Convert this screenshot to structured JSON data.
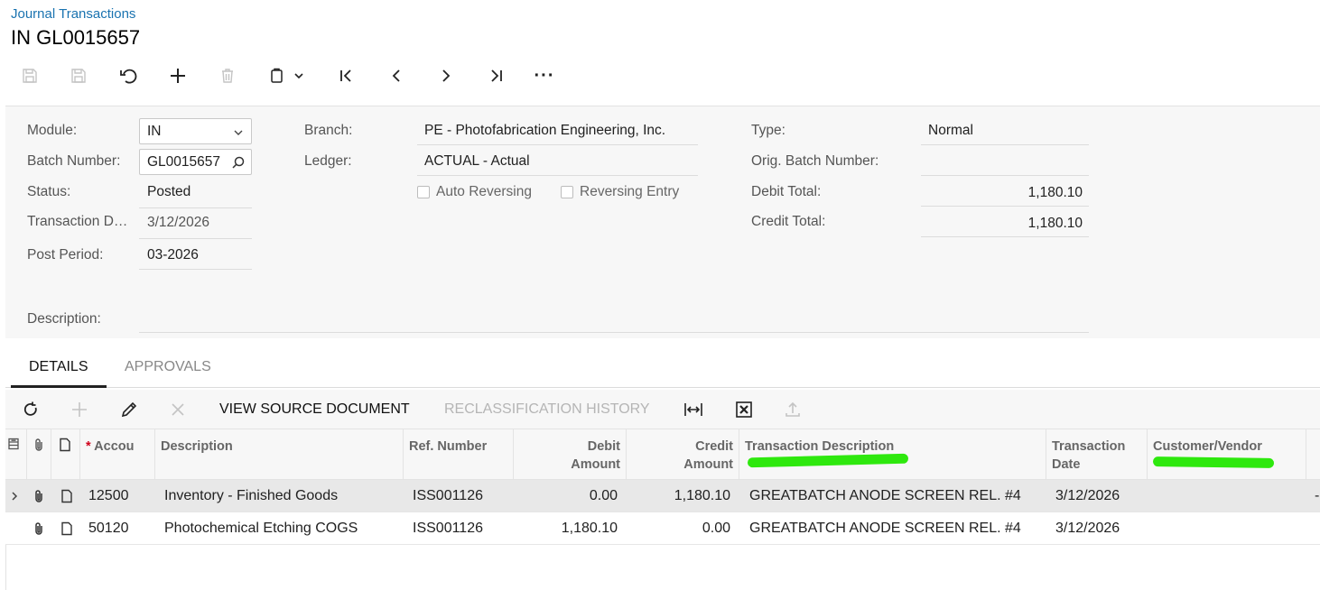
{
  "header": {
    "breadcrumb": "Journal Transactions",
    "title": "IN GL0015657"
  },
  "toolbar": {
    "icons": [
      "save-close-icon",
      "save-icon",
      "undo-icon",
      "add-icon",
      "delete-icon",
      "copy-paste-icon",
      "chevron-down-icon",
      "first-record-icon",
      "previous-icon",
      "next-icon",
      "last-record-icon",
      "more-icon"
    ],
    "more_label": "···"
  },
  "form": {
    "module_label": "Module:",
    "module_value": "IN",
    "batch_label": "Batch Number:",
    "batch_value": "GL0015657",
    "status_label": "Status:",
    "status_value": "Posted",
    "trans_date_label": "Transaction D…",
    "trans_date_value": "3/12/2026",
    "post_period_label": "Post Period:",
    "post_period_value": "03-2026",
    "description_label": "Description:",
    "description_value": "",
    "branch_label": "Branch:",
    "branch_value": "PE - Photofabrication Engineering, Inc.",
    "ledger_label": "Ledger:",
    "ledger_value": "ACTUAL - Actual",
    "auto_reversing_label": "Auto Reversing",
    "reversing_entry_label": "Reversing Entry",
    "type_label": "Type:",
    "type_value": "Normal",
    "orig_batch_label": "Orig. Batch Number:",
    "orig_batch_value": "",
    "debit_total_label": "Debit Total:",
    "debit_total_value": "1,180.10",
    "credit_total_label": "Credit Total:",
    "credit_total_value": "1,180.10"
  },
  "tabs": [
    {
      "label": "DETAILS",
      "active": true
    },
    {
      "label": "APPROVALS",
      "active": false
    }
  ],
  "grid_toolbar": {
    "view_source_label": "VIEW SOURCE DOCUMENT",
    "reclass_label": "RECLASSIFICATION HISTORY"
  },
  "grid": {
    "columns": {
      "account": "Accou",
      "description": "Description",
      "ref_number": "Ref. Number",
      "debit_1": "Debit",
      "debit_2": "Amount",
      "credit_1": "Credit",
      "credit_2": "Amount",
      "trans_desc": "Transaction Description",
      "trans_date_1": "Transaction",
      "trans_date_2": "Date",
      "customer_vendor": "Customer/Vendor"
    },
    "required_mark": "*",
    "rows": [
      {
        "account": "12500",
        "description": "Inventory - Finished Goods",
        "ref": "ISS001126",
        "debit": "0.00",
        "credit": "1,180.10",
        "trans_desc": "GREATBATCH ANODE SCREEN REL. #4",
        "date": "3/12/2026",
        "customer_vendor": ""
      },
      {
        "account": "50120",
        "description": "Photochemical Etching COGS",
        "ref": "ISS001126",
        "debit": "1,180.10",
        "credit": "0.00",
        "trans_desc": "GREATBATCH ANODE SCREEN REL. #4",
        "date": "3/12/2026",
        "customer_vendor": ""
      }
    ],
    "overflow_mark": "-"
  },
  "colors": {
    "link": "#1a73b0",
    "highlight": "#2ee80e",
    "selected_row": "#e8e8e8",
    "required": "#d0021b"
  }
}
